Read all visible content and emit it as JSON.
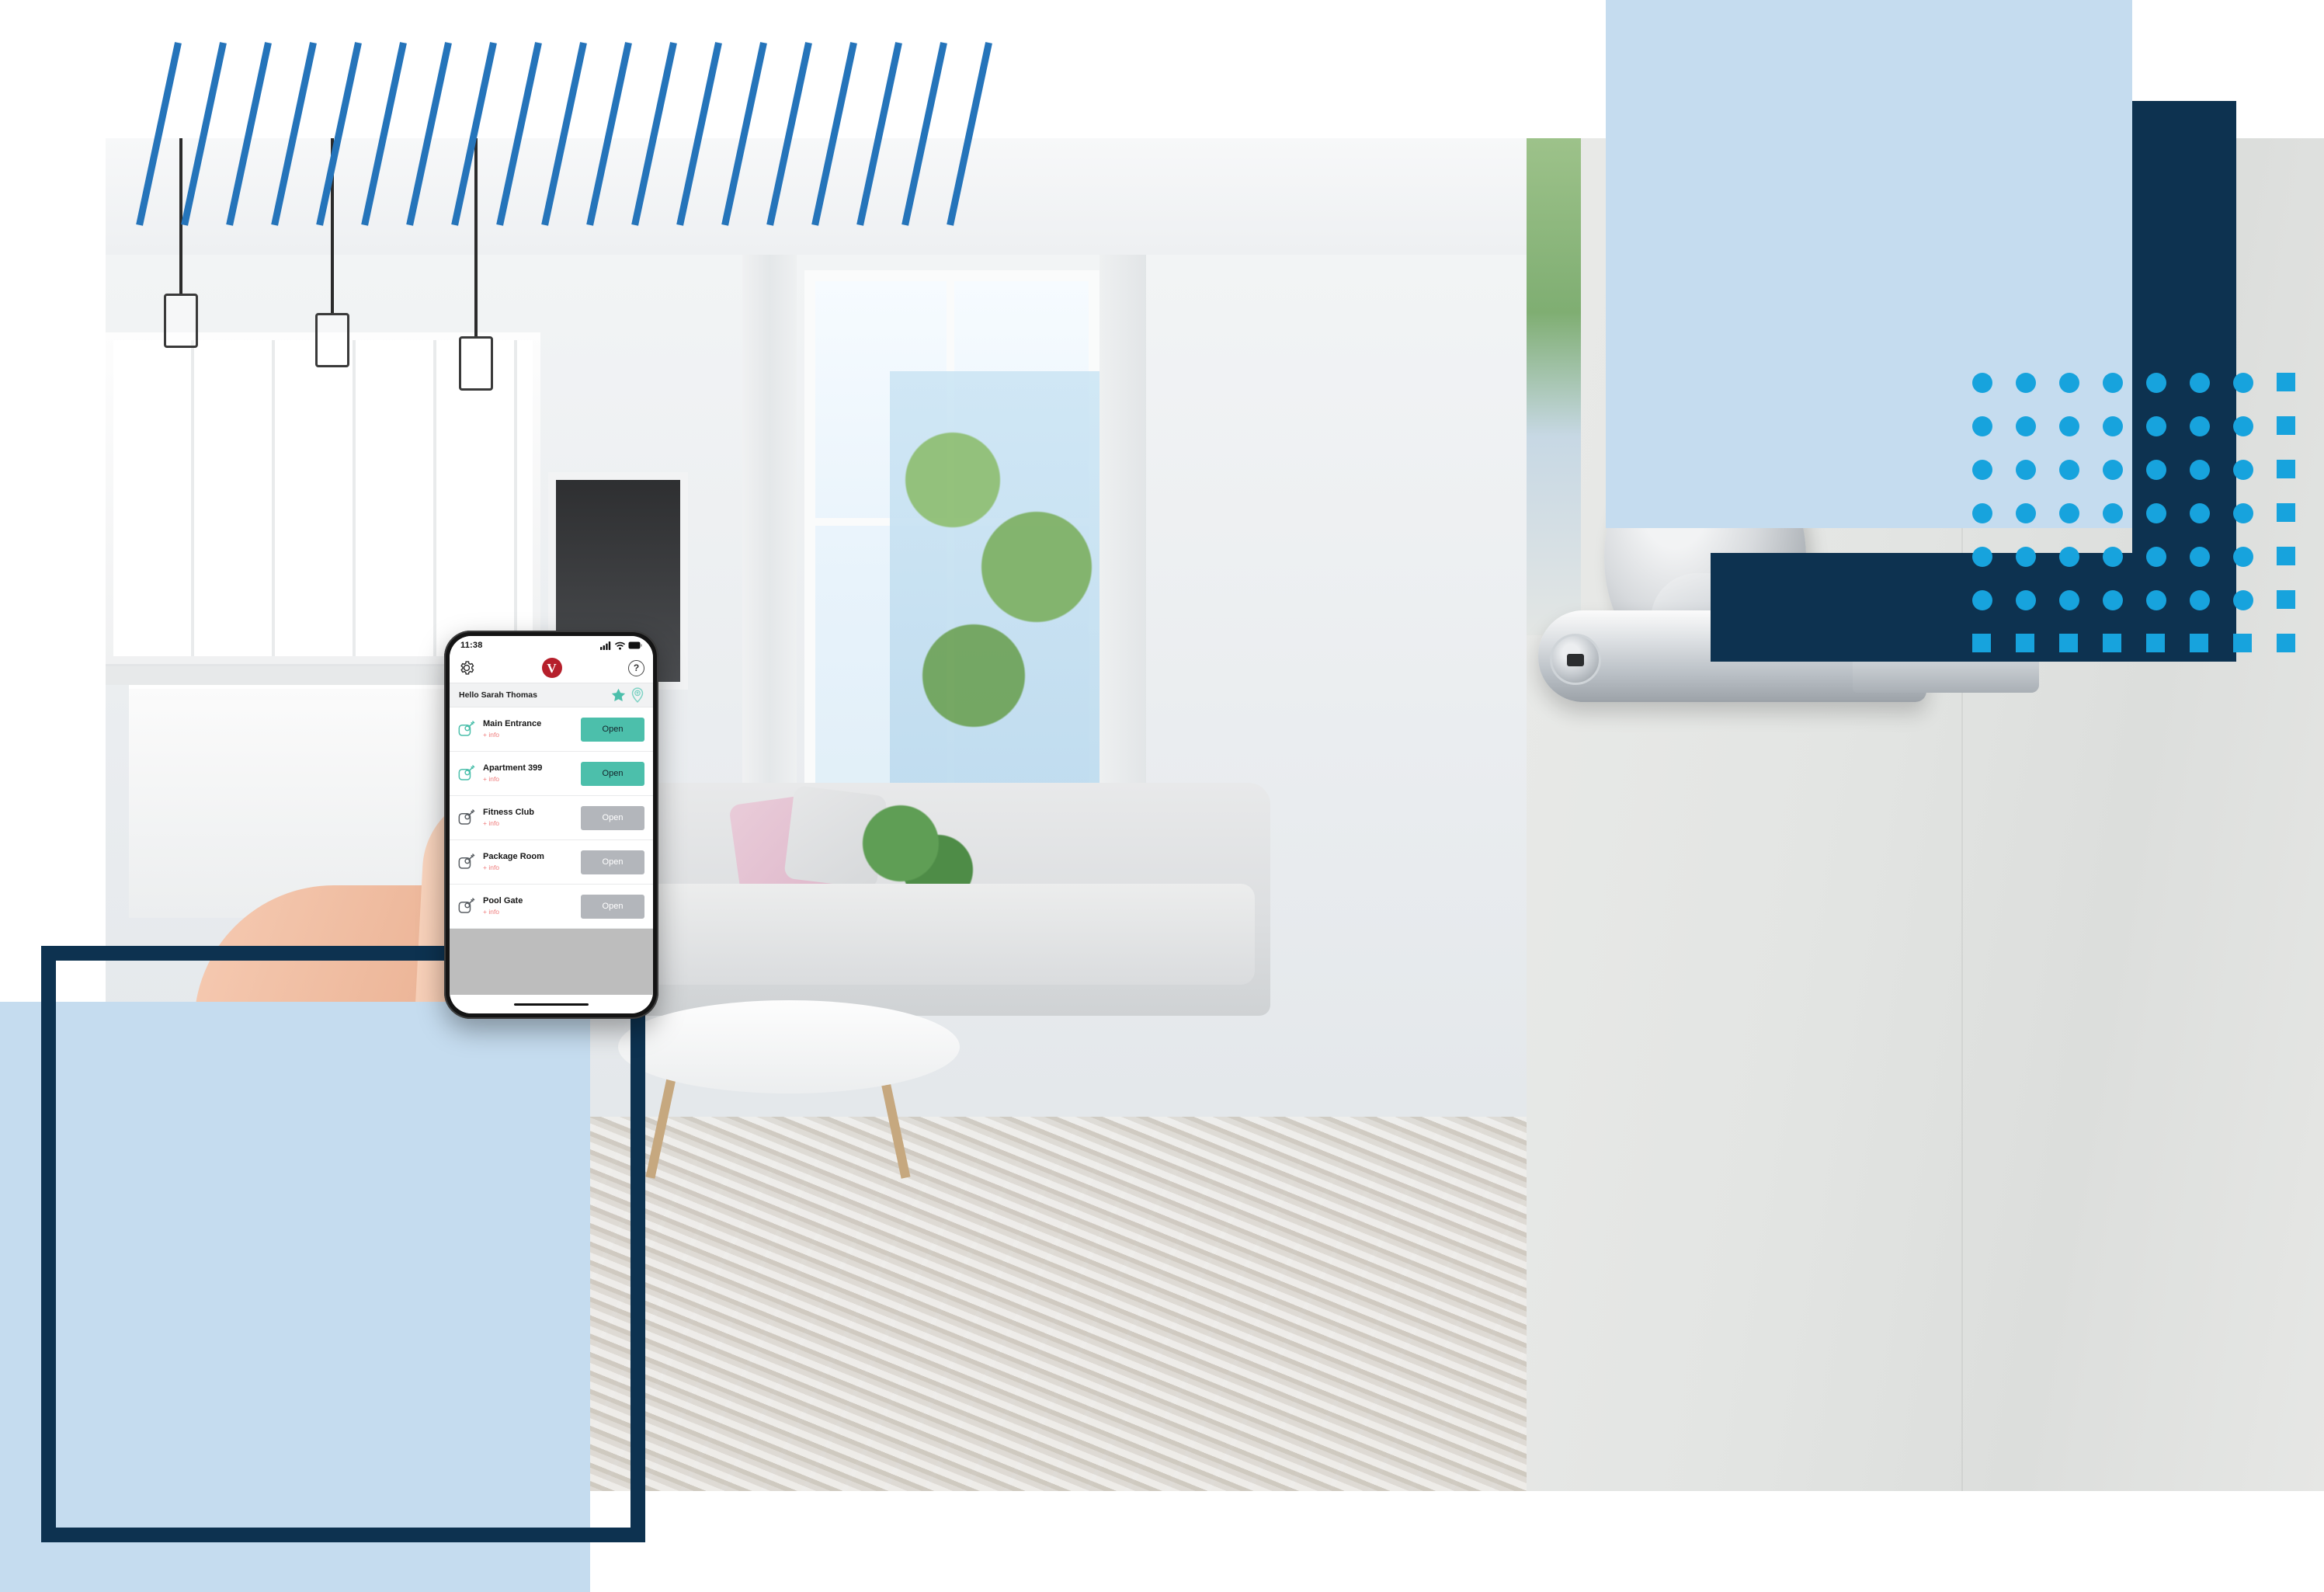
{
  "brand": {
    "accent_teal": "#4cbfab",
    "accent_red": "#b61f2b",
    "navy": "#0d3250",
    "light_blue": "#c5dcef",
    "dot_blue": "#17a3dd",
    "stripe_blue": "#2574ba",
    "logo_letter": "V"
  },
  "phone": {
    "status_bar": {
      "time": "11:38",
      "cellular_icon": "signal-bars-icon",
      "wifi_icon": "wifi-icon",
      "battery_icon": "battery-icon"
    },
    "app_header": {
      "settings_icon": "gear-icon",
      "logo_label": "V",
      "help_label": "?"
    },
    "greeting_bar": {
      "text": "Hello Sarah Thomas",
      "favorite_icon": "star-icon",
      "location_icon": "map-pin-icon"
    },
    "doors": [
      {
        "name": "Main Entrance",
        "info_label": "+ info",
        "button_label": "Open",
        "state": "active",
        "icon": "lock-key-icon"
      },
      {
        "name": "Apartment 399",
        "info_label": "+ info",
        "button_label": "Open",
        "state": "active",
        "icon": "lock-key-icon"
      },
      {
        "name": "Fitness Club",
        "info_label": "+ info",
        "button_label": "Open",
        "state": "inactive",
        "icon": "lock-key-icon"
      },
      {
        "name": "Package Room",
        "info_label": "+ info",
        "button_label": "Open",
        "state": "inactive",
        "icon": "lock-key-icon"
      },
      {
        "name": "Pool Gate",
        "info_label": "+ info",
        "button_label": "Open",
        "state": "inactive",
        "icon": "lock-key-icon"
      }
    ],
    "home_indicator": "home-indicator-bar"
  },
  "photos": {
    "interior": "apartment-kitchen-living-room-photo",
    "door": "door-lever-lock-photo",
    "hand": "hand-holding-phone-photo"
  },
  "decor": {
    "stripes": "diagonal-stripe-pattern",
    "dots": "dot-grid-pattern",
    "light_blue_block_top": "light-blue-rectangle",
    "navy_block_vertical": "navy-rectangle-vertical",
    "navy_block_horizontal": "navy-rectangle-horizontal",
    "light_blue_block_bottom": "light-blue-rectangle",
    "navy_frame": "navy-outline-frame"
  }
}
